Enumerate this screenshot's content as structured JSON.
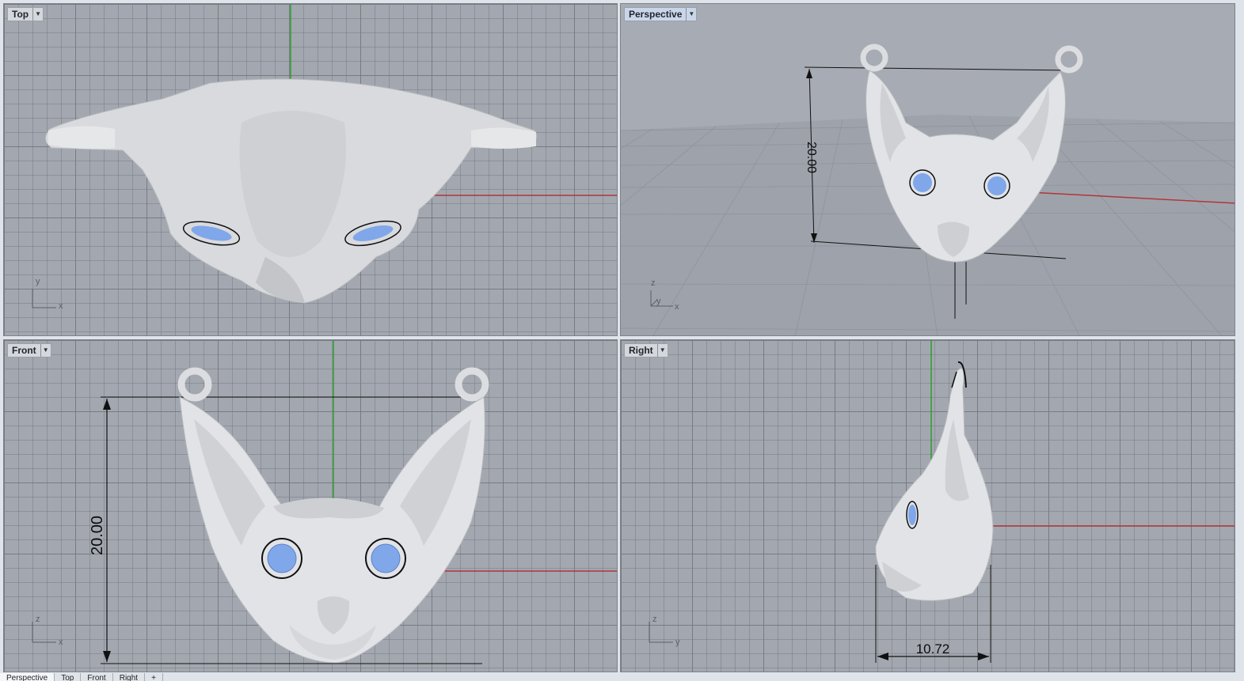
{
  "viewports": {
    "top": {
      "label": "Top",
      "axis_a": "y",
      "axis_b": "x"
    },
    "perspective": {
      "label": "Perspective",
      "axis_z": "z",
      "axis_y": "y",
      "axis_x": "x",
      "dimension": "20.00"
    },
    "front": {
      "label": "Front",
      "axis_a": "z",
      "axis_b": "x",
      "dimension": "20.00"
    },
    "right": {
      "label": "Right",
      "axis_a": "z",
      "axis_b": "y",
      "dimension": "10.72"
    }
  },
  "tabs": [
    "Perspective",
    "Top",
    "Front",
    "Right",
    "+"
  ],
  "colors": {
    "background": "#a3a8b0",
    "grid": "#787c84",
    "x_axis": "#b0363a",
    "y_axis": "#2f9a2f",
    "model": "#e3e4e6",
    "eye": "#7fa7ea"
  },
  "icons": {
    "viewport_menu": "dropdown-caret-icon"
  }
}
